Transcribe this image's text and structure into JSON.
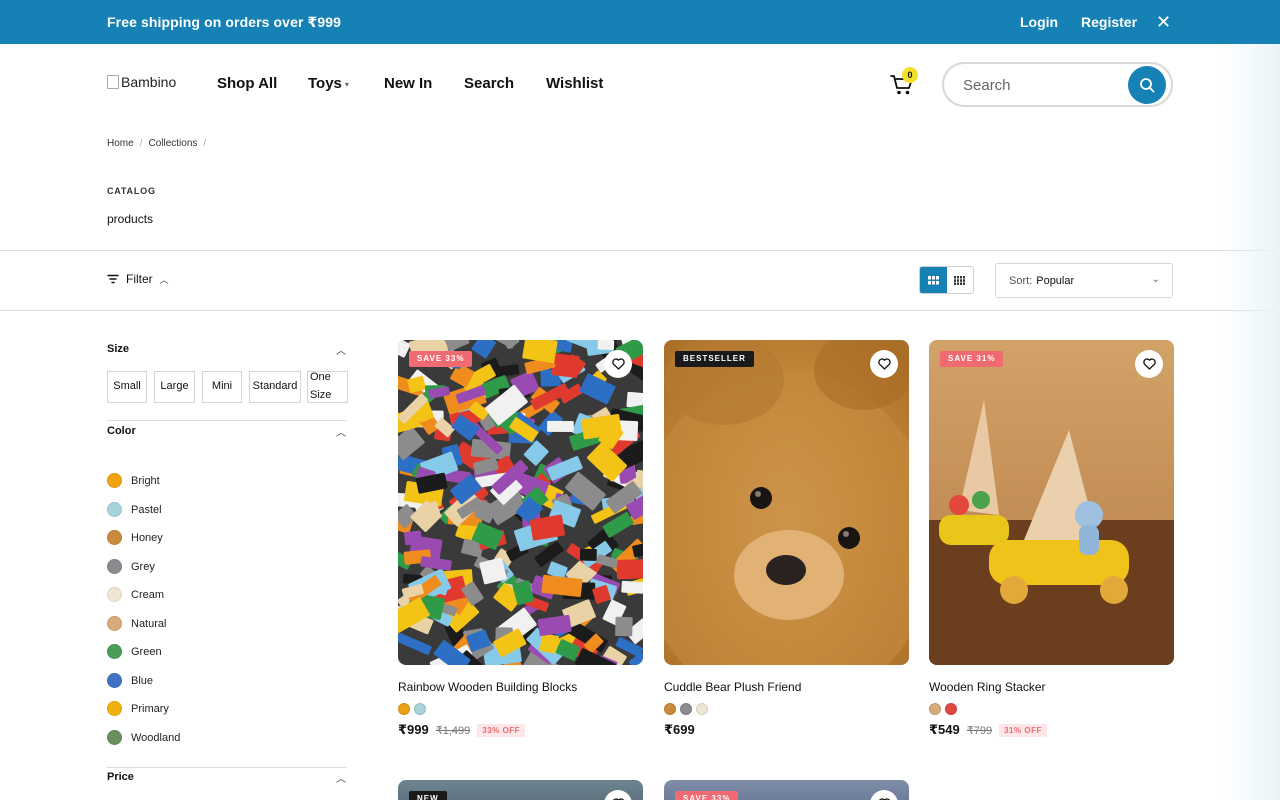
{
  "announcement": {
    "text": "Free shipping on orders over ₹999",
    "login": "Login",
    "register": "Register"
  },
  "header": {
    "logo_alt": "Bambino",
    "nav": [
      "Shop All",
      "Toys",
      "New In",
      "Search",
      "Wishlist"
    ],
    "cart_count": "0",
    "search_placeholder": "Search"
  },
  "breadcrumb": [
    "Home",
    "Collections"
  ],
  "catalog": {
    "eyebrow": "CATALOG",
    "title": "products"
  },
  "toolbar": {
    "filter_label": "Filter",
    "sort_label": "Sort:",
    "sort_value": "Popular"
  },
  "filters": {
    "size": {
      "title": "Size",
      "options": [
        "Small",
        "Large",
        "Mini",
        "Standard",
        "One Size"
      ]
    },
    "color": {
      "title": "Color",
      "options": [
        {
          "label": "Bright",
          "hex": "#f2a20c"
        },
        {
          "label": "Pastel",
          "hex": "#a7d3dc"
        },
        {
          "label": "Honey",
          "hex": "#c88a3c"
        },
        {
          "label": "Grey",
          "hex": "#8b8b8f"
        },
        {
          "label": "Cream",
          "hex": "#efe6d3"
        },
        {
          "label": "Natural",
          "hex": "#d8a97a"
        },
        {
          "label": "Green",
          "hex": "#4b9d57"
        },
        {
          "label": "Blue",
          "hex": "#3f72c4"
        },
        {
          "label": "Primary",
          "hex": "#f0b10d"
        },
        {
          "label": "Woodland",
          "hex": "#6a8f5c"
        }
      ]
    },
    "price": {
      "title": "Price"
    }
  },
  "products": [
    {
      "name": "Rainbow Wooden Building Blocks",
      "badge": "SAVE 33%",
      "badge_type": "sale",
      "colors": [
        "#e8a213",
        "#a7d3dc"
      ],
      "price": "₹999",
      "compare": "₹1,499",
      "off": "33% OFF"
    },
    {
      "name": "Cuddle Bear Plush Friend",
      "badge": "BESTSELLER",
      "badge_type": "best",
      "colors": [
        "#c88a3c",
        "#8b8b8f",
        "#efe6d3"
      ],
      "price": "₹699",
      "compare": "",
      "off": ""
    },
    {
      "name": "Wooden Ring Stacker",
      "badge": "SAVE 31%",
      "badge_type": "sale",
      "colors": [
        "#d8a97a",
        "#e0473e"
      ],
      "price": "₹549",
      "compare": "₹799",
      "off": "31% OFF"
    }
  ],
  "products_row2": [
    {
      "badge": "NEW",
      "badge_type": "best"
    },
    {
      "badge": "SAVE 33%",
      "badge_type": "sale"
    }
  ],
  "theme": {
    "accent": "#1581b5",
    "sale": "#f06a72"
  }
}
